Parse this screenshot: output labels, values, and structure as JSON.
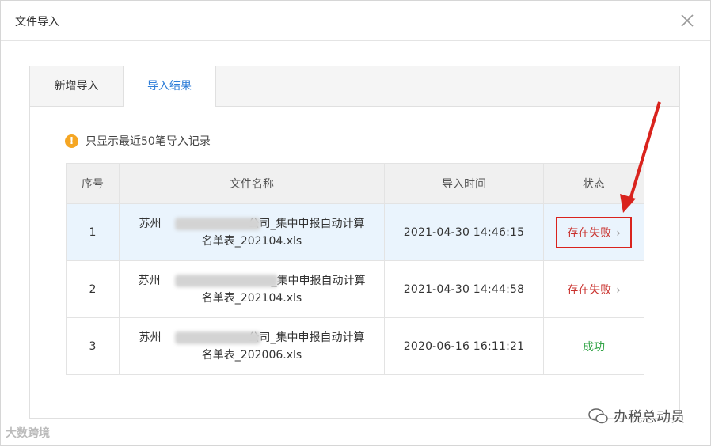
{
  "dialog": {
    "title": "文件导入"
  },
  "tabs": [
    {
      "label": "新增导入",
      "active": false
    },
    {
      "label": "导入结果",
      "active": true
    }
  ],
  "notice": {
    "text": "只显示最近50笔导入记录",
    "icon": "warning-icon"
  },
  "table": {
    "headers": [
      "序号",
      "文件名称",
      "导入时间",
      "状态"
    ],
    "rows": [
      {
        "index": "1",
        "name_prefix": "苏州",
        "name_mid": "公司_集中申报自动计算",
        "name_line2": "名单表_202104.xls",
        "time": "2021-04-30 14:46:15",
        "status": "存在失败",
        "status_type": "fail",
        "highlighted": true
      },
      {
        "index": "2",
        "name_prefix": "苏州",
        "name_mid": "_集中申报自动计算",
        "name_line2": "名单表_202104.xls",
        "time": "2021-04-30 14:44:58",
        "status": "存在失败",
        "status_type": "fail",
        "highlighted": false
      },
      {
        "index": "3",
        "name_prefix": "苏州",
        "name_mid": "公司_集中申报自动计算",
        "name_line2": "名单表_202006.xls",
        "time": "2020-06-16 16:11:21",
        "status": "成功",
        "status_type": "success",
        "highlighted": false
      }
    ]
  },
  "status_chevron": "›",
  "watermark": {
    "right": "办税总动员",
    "left": "大数跨境"
  },
  "colors": {
    "accent": "#2f7ed8",
    "fail": "#c9302c",
    "success": "#36a54a",
    "annotation": "#d9231d"
  }
}
